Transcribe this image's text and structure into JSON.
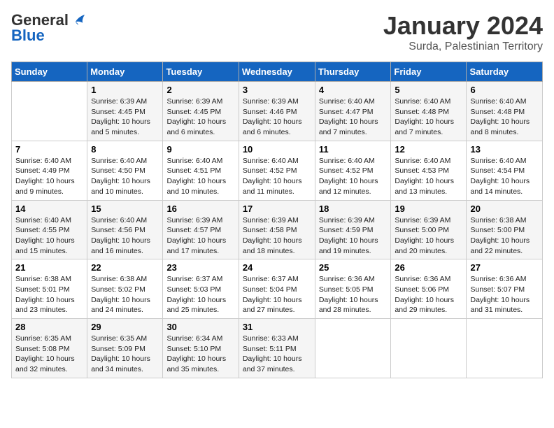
{
  "header": {
    "logo_general": "General",
    "logo_blue": "Blue",
    "title": "January 2024",
    "subtitle": "Surda, Palestinian Territory"
  },
  "days_of_week": [
    "Sunday",
    "Monday",
    "Tuesday",
    "Wednesday",
    "Thursday",
    "Friday",
    "Saturday"
  ],
  "weeks": [
    [
      {
        "num": "",
        "sunrise": "",
        "sunset": "",
        "daylight": ""
      },
      {
        "num": "1",
        "sunrise": "Sunrise: 6:39 AM",
        "sunset": "Sunset: 4:45 PM",
        "daylight": "Daylight: 10 hours and 5 minutes."
      },
      {
        "num": "2",
        "sunrise": "Sunrise: 6:39 AM",
        "sunset": "Sunset: 4:45 PM",
        "daylight": "Daylight: 10 hours and 6 minutes."
      },
      {
        "num": "3",
        "sunrise": "Sunrise: 6:39 AM",
        "sunset": "Sunset: 4:46 PM",
        "daylight": "Daylight: 10 hours and 6 minutes."
      },
      {
        "num": "4",
        "sunrise": "Sunrise: 6:40 AM",
        "sunset": "Sunset: 4:47 PM",
        "daylight": "Daylight: 10 hours and 7 minutes."
      },
      {
        "num": "5",
        "sunrise": "Sunrise: 6:40 AM",
        "sunset": "Sunset: 4:48 PM",
        "daylight": "Daylight: 10 hours and 7 minutes."
      },
      {
        "num": "6",
        "sunrise": "Sunrise: 6:40 AM",
        "sunset": "Sunset: 4:48 PM",
        "daylight": "Daylight: 10 hours and 8 minutes."
      }
    ],
    [
      {
        "num": "7",
        "sunrise": "Sunrise: 6:40 AM",
        "sunset": "Sunset: 4:49 PM",
        "daylight": "Daylight: 10 hours and 9 minutes."
      },
      {
        "num": "8",
        "sunrise": "Sunrise: 6:40 AM",
        "sunset": "Sunset: 4:50 PM",
        "daylight": "Daylight: 10 hours and 10 minutes."
      },
      {
        "num": "9",
        "sunrise": "Sunrise: 6:40 AM",
        "sunset": "Sunset: 4:51 PM",
        "daylight": "Daylight: 10 hours and 10 minutes."
      },
      {
        "num": "10",
        "sunrise": "Sunrise: 6:40 AM",
        "sunset": "Sunset: 4:52 PM",
        "daylight": "Daylight: 10 hours and 11 minutes."
      },
      {
        "num": "11",
        "sunrise": "Sunrise: 6:40 AM",
        "sunset": "Sunset: 4:52 PM",
        "daylight": "Daylight: 10 hours and 12 minutes."
      },
      {
        "num": "12",
        "sunrise": "Sunrise: 6:40 AM",
        "sunset": "Sunset: 4:53 PM",
        "daylight": "Daylight: 10 hours and 13 minutes."
      },
      {
        "num": "13",
        "sunrise": "Sunrise: 6:40 AM",
        "sunset": "Sunset: 4:54 PM",
        "daylight": "Daylight: 10 hours and 14 minutes."
      }
    ],
    [
      {
        "num": "14",
        "sunrise": "Sunrise: 6:40 AM",
        "sunset": "Sunset: 4:55 PM",
        "daylight": "Daylight: 10 hours and 15 minutes."
      },
      {
        "num": "15",
        "sunrise": "Sunrise: 6:40 AM",
        "sunset": "Sunset: 4:56 PM",
        "daylight": "Daylight: 10 hours and 16 minutes."
      },
      {
        "num": "16",
        "sunrise": "Sunrise: 6:39 AM",
        "sunset": "Sunset: 4:57 PM",
        "daylight": "Daylight: 10 hours and 17 minutes."
      },
      {
        "num": "17",
        "sunrise": "Sunrise: 6:39 AM",
        "sunset": "Sunset: 4:58 PM",
        "daylight": "Daylight: 10 hours and 18 minutes."
      },
      {
        "num": "18",
        "sunrise": "Sunrise: 6:39 AM",
        "sunset": "Sunset: 4:59 PM",
        "daylight": "Daylight: 10 hours and 19 minutes."
      },
      {
        "num": "19",
        "sunrise": "Sunrise: 6:39 AM",
        "sunset": "Sunset: 5:00 PM",
        "daylight": "Daylight: 10 hours and 20 minutes."
      },
      {
        "num": "20",
        "sunrise": "Sunrise: 6:38 AM",
        "sunset": "Sunset: 5:00 PM",
        "daylight": "Daylight: 10 hours and 22 minutes."
      }
    ],
    [
      {
        "num": "21",
        "sunrise": "Sunrise: 6:38 AM",
        "sunset": "Sunset: 5:01 PM",
        "daylight": "Daylight: 10 hours and 23 minutes."
      },
      {
        "num": "22",
        "sunrise": "Sunrise: 6:38 AM",
        "sunset": "Sunset: 5:02 PM",
        "daylight": "Daylight: 10 hours and 24 minutes."
      },
      {
        "num": "23",
        "sunrise": "Sunrise: 6:37 AM",
        "sunset": "Sunset: 5:03 PM",
        "daylight": "Daylight: 10 hours and 25 minutes."
      },
      {
        "num": "24",
        "sunrise": "Sunrise: 6:37 AM",
        "sunset": "Sunset: 5:04 PM",
        "daylight": "Daylight: 10 hours and 27 minutes."
      },
      {
        "num": "25",
        "sunrise": "Sunrise: 6:36 AM",
        "sunset": "Sunset: 5:05 PM",
        "daylight": "Daylight: 10 hours and 28 minutes."
      },
      {
        "num": "26",
        "sunrise": "Sunrise: 6:36 AM",
        "sunset": "Sunset: 5:06 PM",
        "daylight": "Daylight: 10 hours and 29 minutes."
      },
      {
        "num": "27",
        "sunrise": "Sunrise: 6:36 AM",
        "sunset": "Sunset: 5:07 PM",
        "daylight": "Daylight: 10 hours and 31 minutes."
      }
    ],
    [
      {
        "num": "28",
        "sunrise": "Sunrise: 6:35 AM",
        "sunset": "Sunset: 5:08 PM",
        "daylight": "Daylight: 10 hours and 32 minutes."
      },
      {
        "num": "29",
        "sunrise": "Sunrise: 6:35 AM",
        "sunset": "Sunset: 5:09 PM",
        "daylight": "Daylight: 10 hours and 34 minutes."
      },
      {
        "num": "30",
        "sunrise": "Sunrise: 6:34 AM",
        "sunset": "Sunset: 5:10 PM",
        "daylight": "Daylight: 10 hours and 35 minutes."
      },
      {
        "num": "31",
        "sunrise": "Sunrise: 6:33 AM",
        "sunset": "Sunset: 5:11 PM",
        "daylight": "Daylight: 10 hours and 37 minutes."
      },
      {
        "num": "",
        "sunrise": "",
        "sunset": "",
        "daylight": ""
      },
      {
        "num": "",
        "sunrise": "",
        "sunset": "",
        "daylight": ""
      },
      {
        "num": "",
        "sunrise": "",
        "sunset": "",
        "daylight": ""
      }
    ]
  ]
}
